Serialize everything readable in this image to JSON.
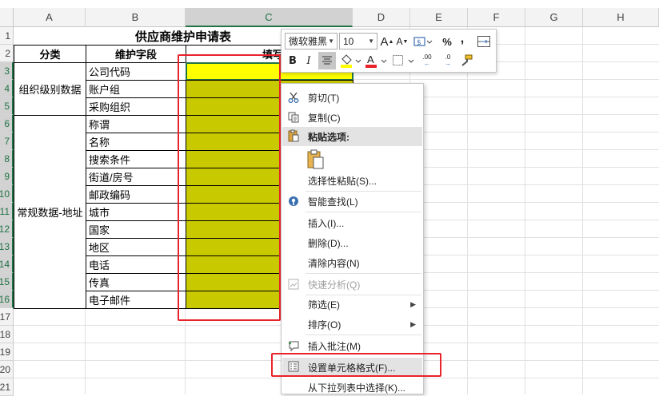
{
  "columns": [
    "A",
    "B",
    "C",
    "D",
    "E",
    "F",
    "G",
    "H"
  ],
  "rows": [
    "1",
    "2",
    "3",
    "4",
    "5",
    "6",
    "7",
    "8",
    "9",
    "10",
    "11",
    "12",
    "13",
    "14",
    "15",
    "16",
    "17",
    "18",
    "19",
    "20",
    "21"
  ],
  "sheet": {
    "title": "供应商维护申请表",
    "header_category": "分类",
    "header_field": "维护字段",
    "header_fill": "填写内容",
    "group_org": "组织级别数据",
    "group_address": "常规数据-地址",
    "fields": [
      "公司代码",
      "账户组",
      "采购组织",
      "称谓",
      "名称",
      "搜索条件",
      "街道/房号",
      "邮政编码",
      "城市",
      "国家",
      "地区",
      "电话",
      "传真",
      "电子邮件"
    ]
  },
  "mini_toolbar": {
    "font_name": "微软雅黑",
    "font_size": "10",
    "grow_font": "A",
    "shrink_font": "A",
    "percent": "%",
    "comma": ",",
    "bold": "B",
    "italic": "I",
    "font_color_letter": "A",
    "inc_decimal": ".00",
    "dec_decimal": ".0"
  },
  "context_menu": {
    "cut": "剪切(T)",
    "copy": "复制(C)",
    "paste_options": "粘贴选项:",
    "paste_special": "选择性粘贴(S)...",
    "smart_lookup": "智能查找(L)",
    "insert": "插入(I)...",
    "delete": "删除(D)...",
    "clear_contents": "清除内容(N)",
    "quick_analysis": "快速分析(Q)",
    "filter": "筛选(E)",
    "sort": "排序(O)",
    "insert_comment": "插入批注(M)",
    "format_cells": "设置单元格格式(F)...",
    "pick_from_list": "从下拉列表中选择(K)..."
  },
  "colors": {
    "highlight_yellow": "#ffff00",
    "selected_olive": "#c9c900",
    "annotation_red": "#e8232a",
    "excel_green": "#217346"
  }
}
